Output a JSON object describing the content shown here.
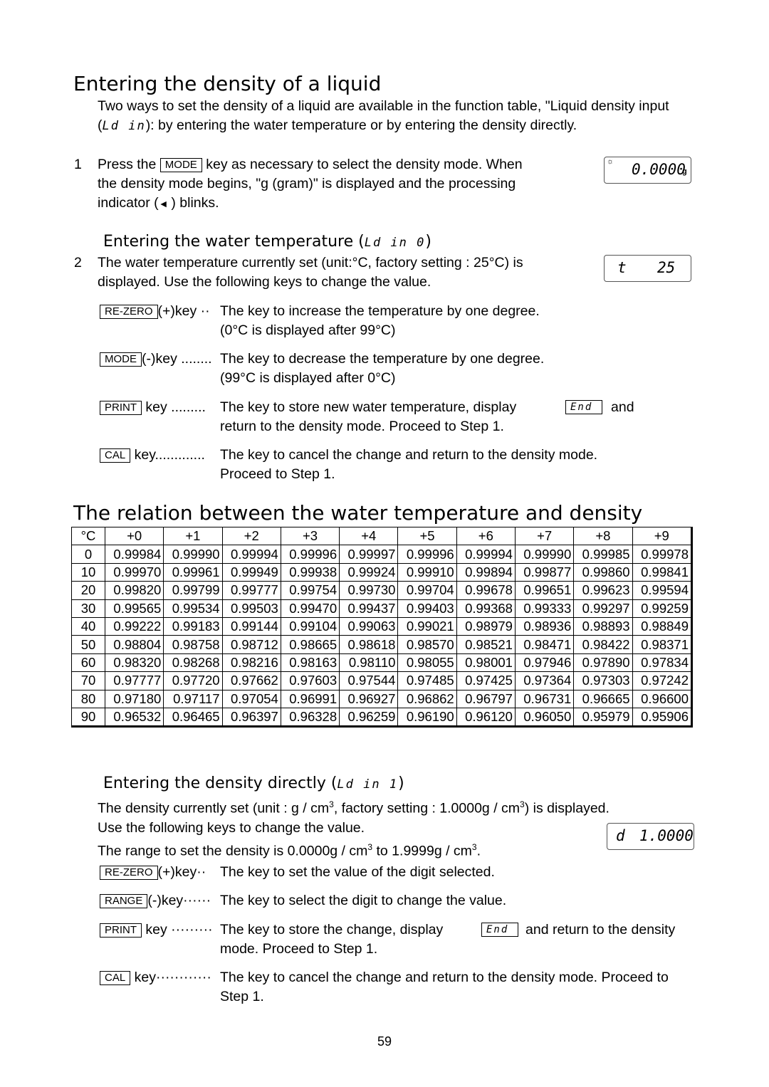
{
  "section1": {
    "title": "Entering the density of a liquid",
    "intro1": "Two ways to set the density of a liquid are available in the function table, \"Liquid density input",
    "intro2_seg": "Ld in",
    "intro2": "): by entering the water temperature or by entering the density directly.",
    "step1_num": "1",
    "step1_a": "Press the",
    "step1_key": "MODE",
    "step1_b": "key as necessary to select the density mode. When",
    "step1_c": "the density mode begins, \"g (gram)\" is displayed and the processing",
    "step1_d": "indicator (",
    "step1_e": ") blinks.",
    "display1": "0.0000",
    "display1_unit": "g"
  },
  "section2": {
    "title": "Entering the water temperature (",
    "title_seg": "Ld in 0",
    "step2_num": "2",
    "step2_a": "The water temperature currently set (unit:°C, factory setting : 25°C) is",
    "step2_b": "displayed. Use the following keys to change the value.",
    "display_label": "t",
    "display_value": "25",
    "keys": [
      {
        "key": "RE-ZERO",
        "suffix": "(+)key ··",
        "desc": "The key to increase the temperature by one degree.",
        "desc2": "(0°C is displayed after 99°C)"
      },
      {
        "key": "MODE",
        "suffix": "(-)key ........",
        "desc": "The key to decrease the temperature by one degree.",
        "desc2": "(99°C is displayed after 0°C)"
      },
      {
        "key": "PRINT",
        "suffix": " key .........",
        "desc": "The key to store new water temperature, display",
        "seg": "End",
        "desc_b": "and",
        "desc2": "return to the density mode. Proceed to Step 1."
      },
      {
        "key": "CAL",
        "suffix": " key.............",
        "desc": "The key to cancel the change and return to the density mode.",
        "desc2": "Proceed to Step 1."
      }
    ]
  },
  "section3": {
    "title": "The relation between the water temperature and density",
    "table": {
      "headers": [
        "°C",
        "+0",
        "+1",
        "+2",
        "+3",
        "+4",
        "+5",
        "+6",
        "+7",
        "+8",
        "+9"
      ],
      "rows": [
        [
          "0",
          "0.99984",
          "0.99990",
          "0.99994",
          "0.99996",
          "0.99997",
          "0.99996",
          "0.99994",
          "0.99990",
          "0.99985",
          "0.99978"
        ],
        [
          "10",
          "0.99970",
          "0.99961",
          "0.99949",
          "0.99938",
          "0.99924",
          "0.99910",
          "0.99894",
          "0.99877",
          "0.99860",
          "0.99841"
        ],
        [
          "20",
          "0.99820",
          "0.99799",
          "0.99777",
          "0.99754",
          "0.99730",
          "0.99704",
          "0.99678",
          "0.99651",
          "0.99623",
          "0.99594"
        ],
        [
          "30",
          "0.99565",
          "0.99534",
          "0.99503",
          "0.99470",
          "0.99437",
          "0.99403",
          "0.99368",
          "0.99333",
          "0.99297",
          "0.99259"
        ],
        [
          "40",
          "0.99222",
          "0.99183",
          "0.99144",
          "0.99104",
          "0.99063",
          "0.99021",
          "0.98979",
          "0.98936",
          "0.98893",
          "0.98849"
        ],
        [
          "50",
          "0.98804",
          "0.98758",
          "0.98712",
          "0.98665",
          "0.98618",
          "0.98570",
          "0.98521",
          "0.98471",
          "0.98422",
          "0.98371"
        ],
        [
          "60",
          "0.98320",
          "0.98268",
          "0.98216",
          "0.98163",
          "0.98110",
          "0.98055",
          "0.98001",
          "0.97946",
          "0.97890",
          "0.97834"
        ],
        [
          "70",
          "0.97777",
          "0.97720",
          "0.97662",
          "0.97603",
          "0.97544",
          "0.97485",
          "0.97425",
          "0.97364",
          "0.97303",
          "0.97242"
        ],
        [
          "80",
          "0.97180",
          "0.97117",
          "0.97054",
          "0.96991",
          "0.96927",
          "0.96862",
          "0.96797",
          "0.96731",
          "0.96665",
          "0.96600"
        ],
        [
          "90",
          "0.96532",
          "0.96465",
          "0.96397",
          "0.96328",
          "0.96259",
          "0.96190",
          "0.96120",
          "0.96050",
          "0.95979",
          "0.95906"
        ]
      ]
    }
  },
  "section4": {
    "title": "Entering the density directly (",
    "title_seg": "Ld in  1",
    "line1_a": "The density currently set (unit : g / cm",
    "line1_b": ", factory setting : 1.0000g / cm",
    "line1_c": ") is displayed.",
    "sup": "3",
    "line2": "Use the following keys to change the value.",
    "line3_a": "The range to set the density is 0.0000g / cm",
    "line3_b": " to 1.9999g / cm",
    "line3_c": ".",
    "display_label": "d",
    "display_value": "1.0000",
    "keys": [
      {
        "key": "RE-ZERO",
        "suffix": "(+)key··",
        "desc": "The key to set the value of the digit selected."
      },
      {
        "key": "RANGE",
        "suffix": "(-)key······",
        "desc": "The key to select the digit to change the value."
      },
      {
        "key": "PRINT",
        "suffix": " key ·········",
        "desc": "The key to store the change, display",
        "seg": "End",
        "desc_b": "and return to the density",
        "desc2": "mode. Proceed to Step 1."
      },
      {
        "key": "CAL",
        "suffix": " key············",
        "desc": "The key to cancel the change and return to the density mode. Proceed to",
        "desc2": "Step 1."
      }
    ]
  },
  "page_number": "59"
}
